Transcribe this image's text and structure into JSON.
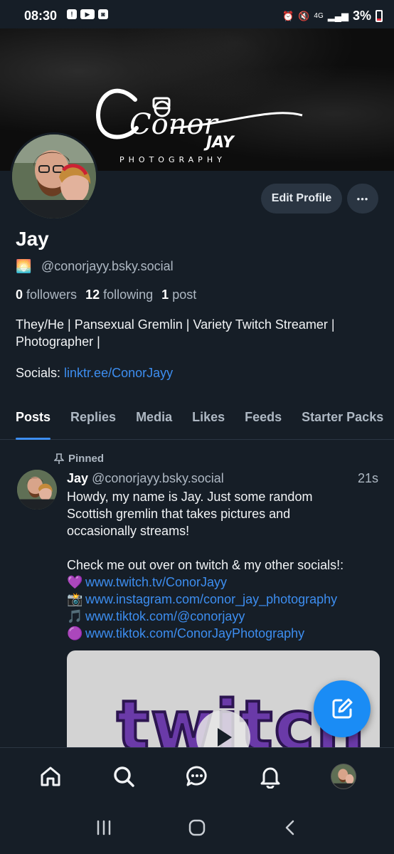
{
  "status_bar": {
    "time": "08:30",
    "network": "4G",
    "battery": "3%"
  },
  "profile": {
    "display_name": "Jay",
    "handle_emoji": "🌅",
    "handle": "@conorjayy.bsky.social",
    "edit_profile_label": "Edit Profile",
    "more_label": "•••",
    "followers_count": "0",
    "followers_label": "followers",
    "following_count": "12",
    "following_label": "following",
    "posts_count": "1",
    "posts_label": "post",
    "bio_line1": "They/He | Pansexual Gremlin | Variety Twitch Streamer |",
    "bio_line2": "Photographer |",
    "socials_label": "Socials:",
    "socials_link": "linktr.ee/ConorJayy",
    "banner_logo_script": "Conor",
    "banner_logo_jay": "JAY",
    "banner_logo_sub": "PHOTOGRAPHY"
  },
  "tabs": [
    {
      "label": "Posts",
      "active": true
    },
    {
      "label": "Replies",
      "active": false
    },
    {
      "label": "Media",
      "active": false
    },
    {
      "label": "Likes",
      "active": false
    },
    {
      "label": "Feeds",
      "active": false
    },
    {
      "label": "Starter Packs",
      "active": false
    }
  ],
  "post": {
    "pinned_label": "Pinned",
    "author": "Jay",
    "handle": "@conorjayy.bsky.social",
    "time": "21s",
    "text_lines": [
      "Howdy, my name is Jay. Just some random",
      "Scottish gremlin that takes pictures and",
      "occasionally streams!",
      "",
      "Check me out over on twitch & my other socials!:"
    ],
    "links": [
      {
        "emoji": "💜",
        "url": "www.twitch.tv/ConorJayy"
      },
      {
        "emoji": "📸",
        "url": "www.instagram.com/conor_jay_photography"
      },
      {
        "emoji": "🎵",
        "url": "www.tiktok.com/@conorjayy"
      },
      {
        "emoji": "🟣",
        "url": "www.tiktok.com/ConorJayPhotography"
      }
    ],
    "video_text": "twitch"
  },
  "colors": {
    "background": "#161e27",
    "accent": "#3d8ef0",
    "fab": "#1a8cf5",
    "muted": "#aeb8c3"
  },
  "icons": {
    "nav": [
      "home-icon",
      "search-icon",
      "chat-icon",
      "bell-icon",
      "profile-avatar"
    ],
    "android": [
      "recents-icon",
      "home-circle-icon",
      "back-icon"
    ],
    "fab": "compose-icon"
  }
}
